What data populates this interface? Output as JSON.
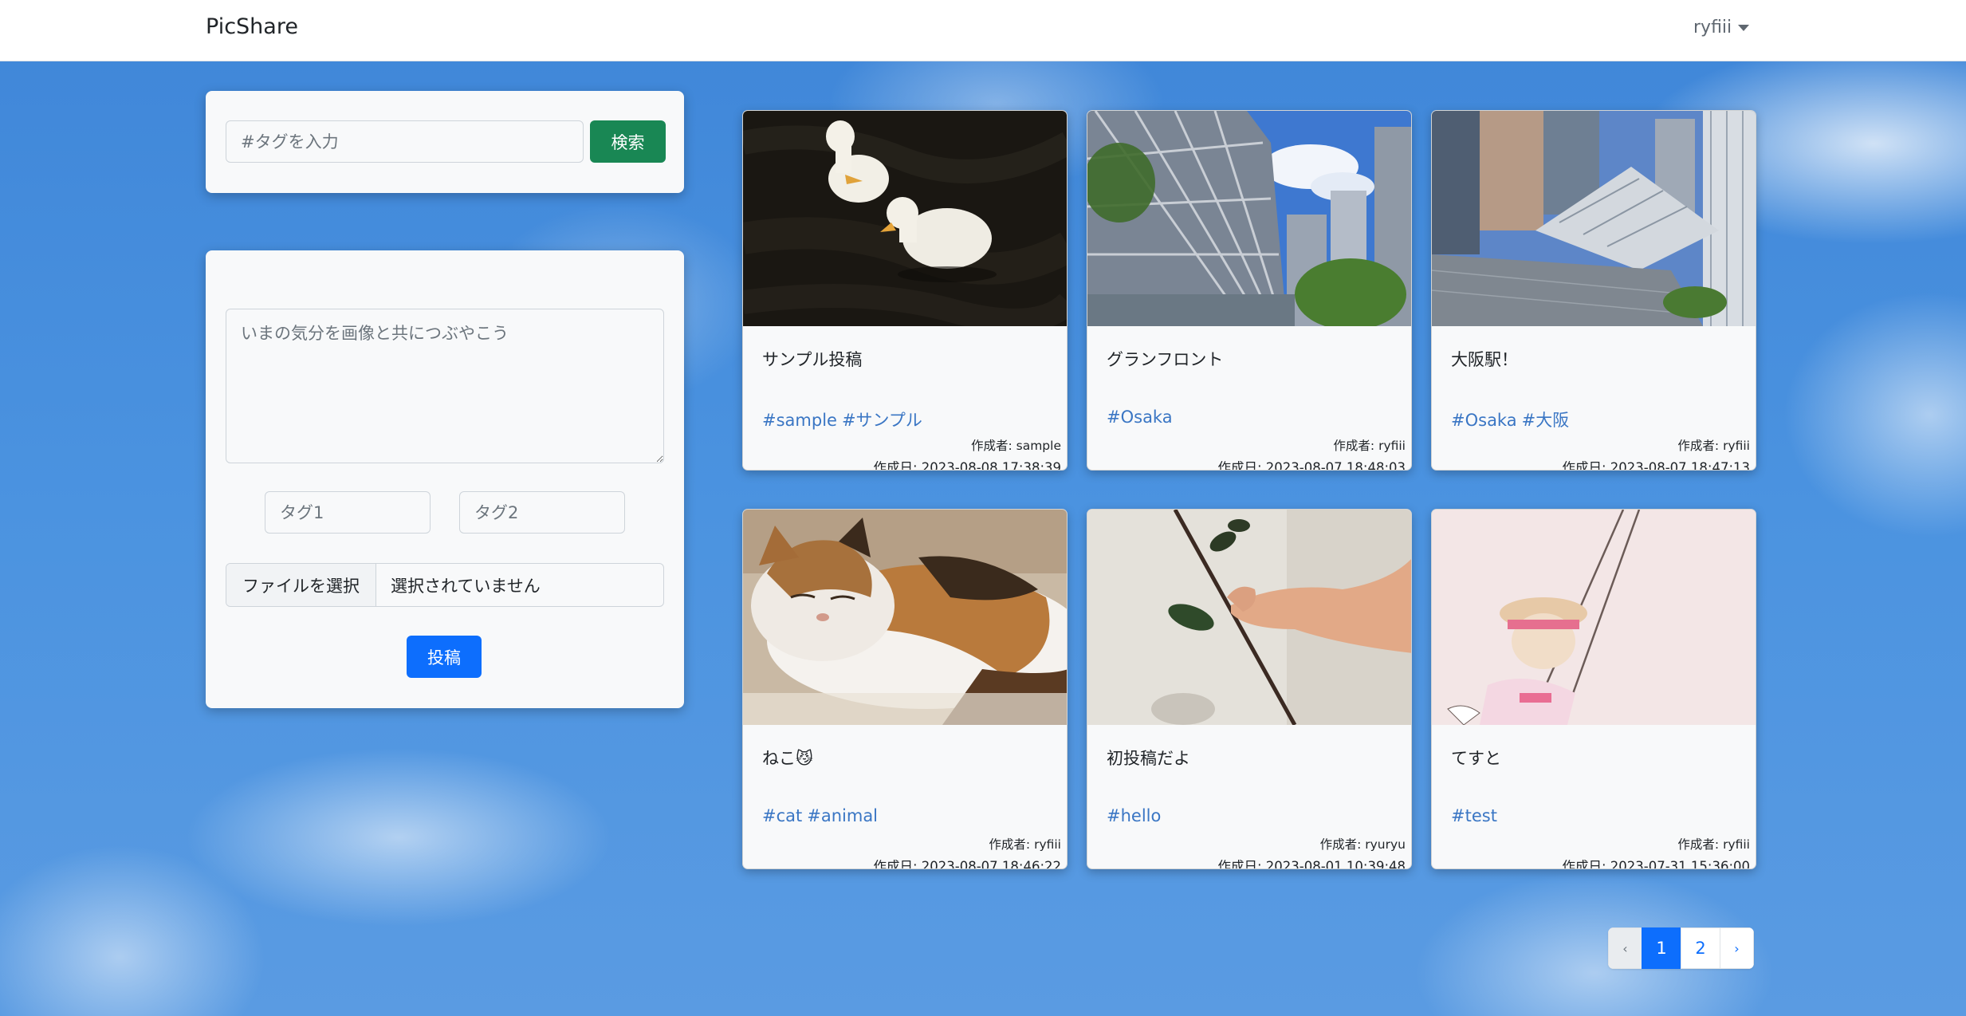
{
  "navbar": {
    "brand": "PicShare",
    "user": "ryfiii"
  },
  "search": {
    "placeholder": "#タグを入力",
    "button": "検索"
  },
  "post_form": {
    "textarea_placeholder": "いまの気分を画像と共につぶやこう",
    "tag1_placeholder": "タグ1",
    "tag2_placeholder": "タグ2",
    "file_button": "ファイルを選択",
    "file_status": "選択されていません",
    "submit": "投稿"
  },
  "posts": [
    {
      "title": "サンプル投稿",
      "tags": [
        "#sample",
        "#サンプル"
      ],
      "author": "作成者: sample",
      "date": "作成日: 2023-08-08 17:38:39",
      "image": "ducks-photo"
    },
    {
      "title": "グランフロント",
      "tags": [
        "#Osaka"
      ],
      "author": "作成者: ryfiii",
      "date": "作成日: 2023-08-07 18:48:03",
      "image": "building-photo"
    },
    {
      "title": "大阪駅！",
      "tags": [
        "#Osaka",
        "#大阪"
      ],
      "author": "作成者: ryfiii",
      "date": "作成日: 2023-08-07 18:47:13",
      "image": "station-photo"
    },
    {
      "title": "ねこ😼",
      "tags": [
        "#cat",
        "#animal"
      ],
      "author": "作成者: ryfiii",
      "date": "作成日: 2023-08-07 18:46:22",
      "image": "cat-photo"
    },
    {
      "title": "初投稿だよ",
      "tags": [
        "#hello"
      ],
      "author": "作成者: ryuryu",
      "date": "作成日: 2023-08-01 10:39:48",
      "image": "flower-hand-photo"
    },
    {
      "title": "てすと",
      "tags": [
        "#test"
      ],
      "author": "作成者: ryfiii",
      "date": "作成日: 2023-07-31 15:36:00",
      "image": "swing-illustration"
    }
  ],
  "pagination": {
    "prev": "‹",
    "pages": [
      "1",
      "2"
    ],
    "next": "›",
    "current": "1"
  }
}
